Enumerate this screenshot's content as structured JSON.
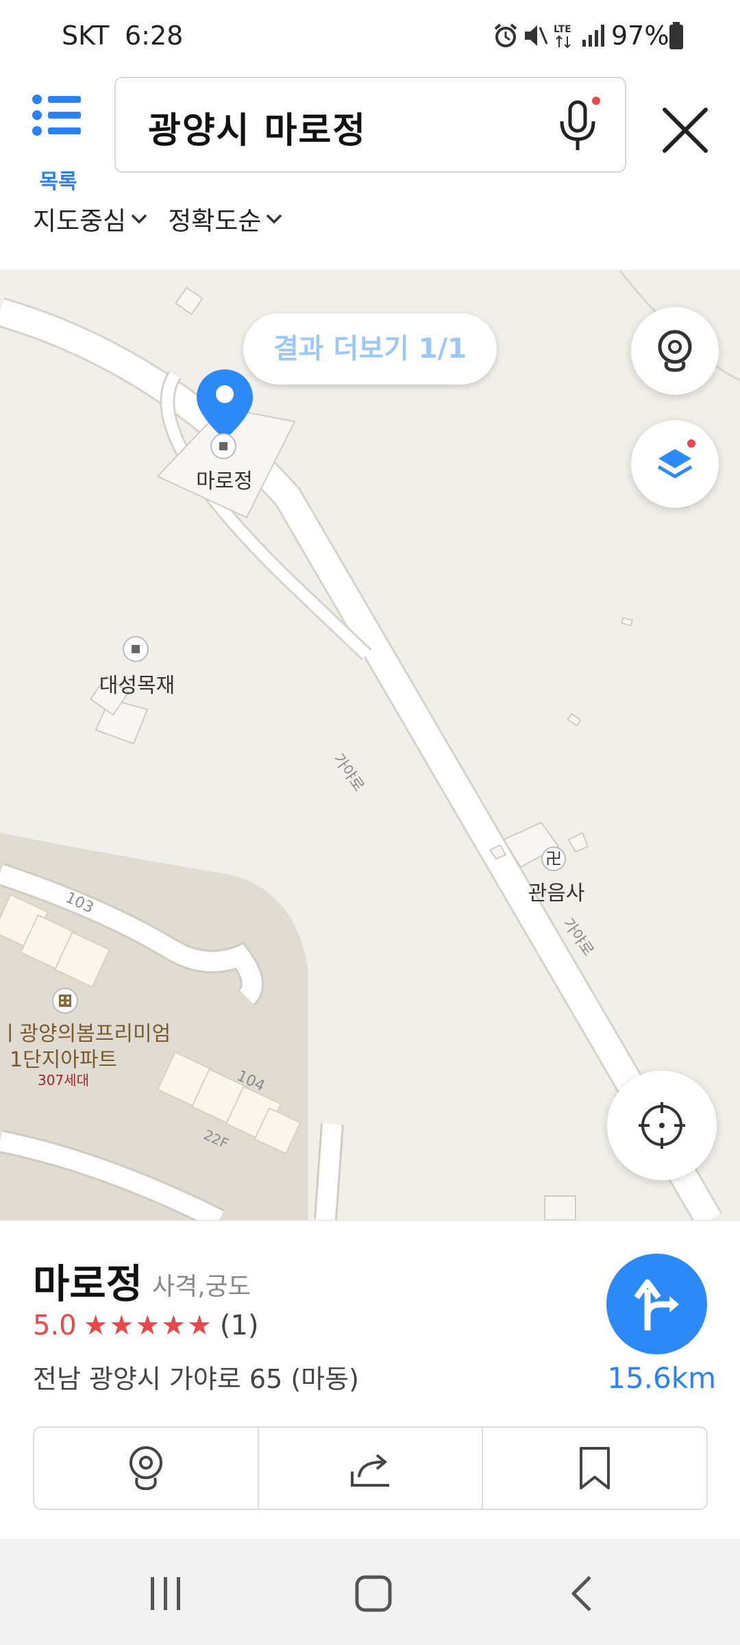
{
  "status_bar": {
    "carrier": "SKT",
    "time": "6:28",
    "battery_percent": "97%",
    "icons": [
      "alarm-icon",
      "mute-icon",
      "lte-icon",
      "signal-icon",
      "battery-icon"
    ],
    "lte_label": "LTE"
  },
  "header": {
    "list_label": "목록",
    "search_query": "광양시 마로정",
    "filters": [
      "지도중심",
      "정확도순"
    ]
  },
  "map": {
    "more_results": "결과 더보기 1/1",
    "places": {
      "selected": "마로정",
      "lumber": "대성목재",
      "temple": "관음사",
      "temple_symbol": "卍",
      "apartment_line1": "광양의봄프리미엄",
      "apartment_line1_prefix": "ㅣ",
      "apartment_line2": "1단지아파트",
      "apartment_units": "307세대"
    },
    "road_name": "가야로",
    "building_numbers": [
      "103",
      "104"
    ],
    "floors_label": "22F"
  },
  "panel": {
    "name": "마로정",
    "category": "사격,궁도",
    "rating": "5.0",
    "stars": "★★★★★",
    "review_count": "(1)",
    "address": "전남 광양시 가야로 65 (마동)",
    "distance": "15.6km"
  },
  "colors": {
    "accent": "#2b80f5",
    "rating": "#e8474b",
    "map_bg": "#f1efe9",
    "road": "#ffffff"
  }
}
